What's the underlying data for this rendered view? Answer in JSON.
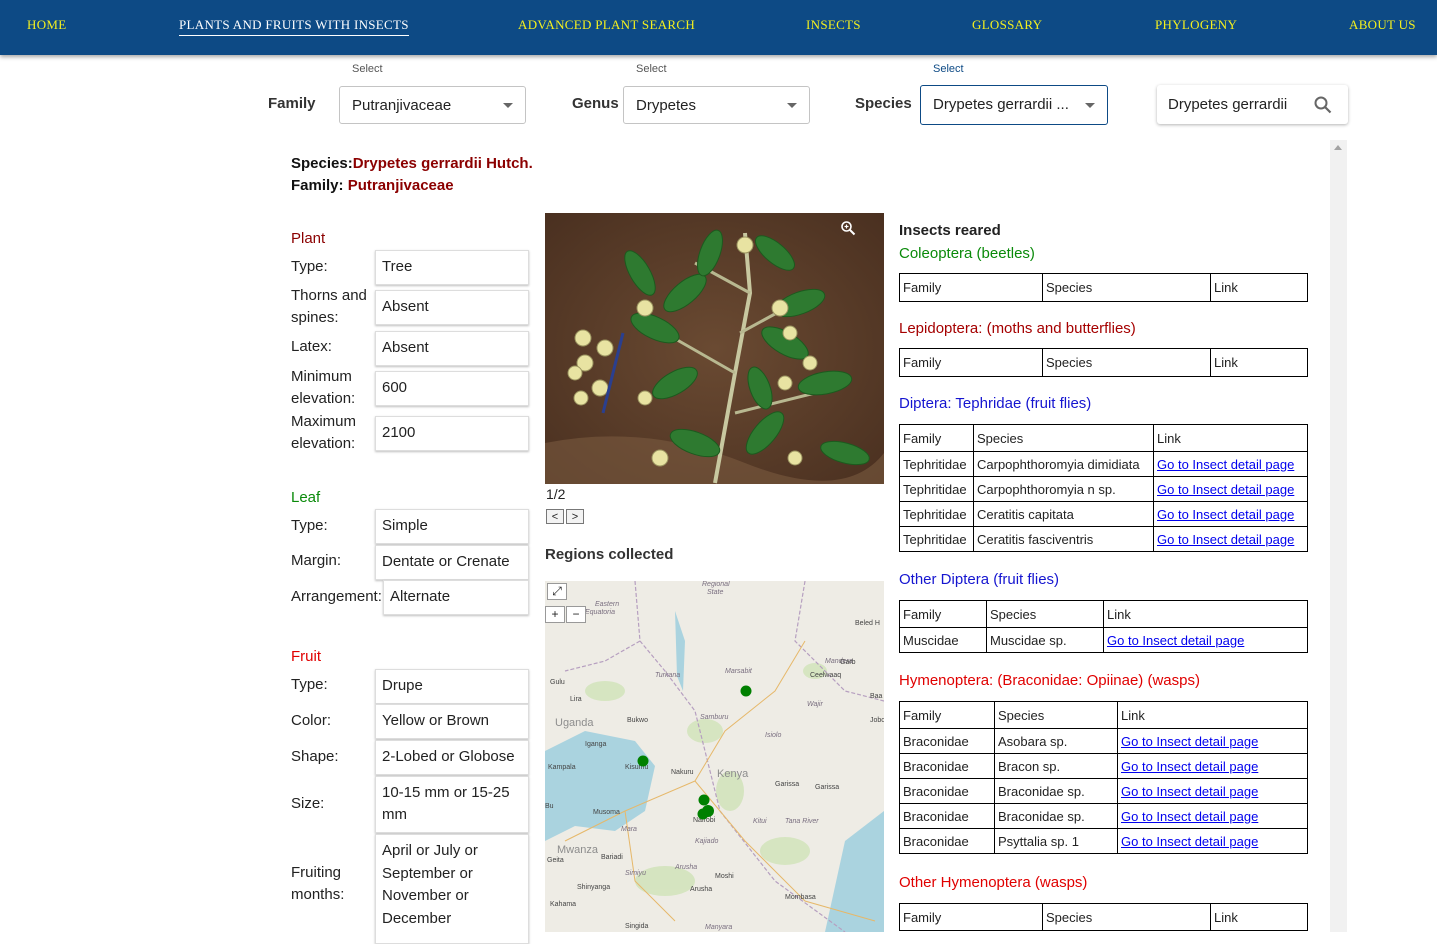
{
  "nav": {
    "home": "HOME",
    "plants": "PLANTS AND FRUITS WITH INSECTS",
    "advanced": "ADVANCED PLANT SEARCH",
    "insects": "INSECTS",
    "glossary": "GLOSSARY",
    "phylogeny": "PHYLOGENY",
    "about": "ABOUT US"
  },
  "filters": {
    "caption": "Select",
    "family_label": "Family",
    "family_value": "Putranjivaceae",
    "genus_label": "Genus",
    "genus_value": "Drypetes",
    "species_label": "Species",
    "species_value": "Drypetes gerrardii ...",
    "search_value": "Drypetes gerrardii",
    "search_icon": "search-icon"
  },
  "header": {
    "species_key": "Species:",
    "species_value": "Drypetes gerrardii Hutch.",
    "family_key": "Family: ",
    "family_value": "Putranjivaceae"
  },
  "plant": {
    "title": "Plant",
    "type_label": "Type:",
    "type": "Tree",
    "thorns_label": "Thorns and spines:",
    "thorns": "Absent",
    "latex_label": "Latex:",
    "latex": "Absent",
    "min_label": "Minimum elevation:",
    "min": "600",
    "max_label": "Maximum elevation:",
    "max": "2100"
  },
  "leaf": {
    "title": "Leaf",
    "type_label": "Type:",
    "type": "Simple",
    "margin_label": "Margin:",
    "margin": "Dentate or Crenate",
    "arrangement_label": "Arrangement:",
    "arrangement": "Alternate"
  },
  "fruit": {
    "title": "Fruit",
    "type_label": "Type:",
    "type": "Drupe",
    "color_label": "Color:",
    "color": "Yellow or Brown",
    "shape_label": "Shape:",
    "shape": "2-Lobed or Globose",
    "size_label": "Size:",
    "size": "10-15 mm or 15-25 mm",
    "months_label": "Fruiting months:",
    "months": "April or July or September or November or December"
  },
  "gallery": {
    "counter": "1/2",
    "prev": "<",
    "next": ">",
    "zoom_icon": "zoom-in-icon"
  },
  "regions": {
    "title": "Regions collected",
    "fullscreen": "⤢",
    "zoom_in": "+",
    "zoom_out": "−",
    "places": [
      "Eastern Equatoria",
      "Turkana",
      "Marsabit",
      "Wajir",
      "Mandera",
      "Garba",
      "Beled H",
      "Ceelwaaq",
      "Baa",
      "Gulu",
      "Lira",
      "Uganda",
      "Bukwo",
      "Samburu",
      "Isiolo",
      "Jobo",
      "Iganga",
      "Kampala",
      "Kisumu",
      "Nakuru",
      "Kenya",
      "Garissa",
      "Bu",
      "Musoma",
      "Mara",
      "Nairobi",
      "Kitui",
      "Tana River",
      "Kajiado",
      "Mwanza",
      "Bariadi",
      "Geita",
      "Simiyu",
      "Arusha",
      "Moshi",
      "Shinyanga",
      "Mombasa",
      "Kahama",
      "Singida",
      "Manyara",
      "Regional State",
      "Garissa"
    ],
    "colors": {
      "marker": "#008000"
    }
  },
  "insects": {
    "title": "Insects reared",
    "headers": [
      "Family",
      "Species",
      "Link"
    ],
    "link_text": "Go to Insect detail page",
    "coleoptera": {
      "title": "Coleoptera (beetles)",
      "rows": []
    },
    "lepidoptera": {
      "title": "Lepidoptera: (moths and butterflies)",
      "rows": []
    },
    "tephritidae": {
      "title": "Diptera: Tephridae (fruit flies)",
      "rows": [
        [
          "Tephritidae",
          "Carpophthoromyia dimidiata"
        ],
        [
          "Tephritidae",
          "Carpophthoromyia n sp."
        ],
        [
          "Tephritidae",
          "Ceratitis capitata"
        ],
        [
          "Tephritidae",
          "Ceratitis fasciventris"
        ]
      ]
    },
    "other_diptera": {
      "title": "Other Diptera (fruit flies)",
      "rows": [
        [
          "Muscidae",
          "Muscidae sp."
        ]
      ]
    },
    "hymenoptera": {
      "title": "Hymenoptera: (Braconidae: Opiinae) (wasps)",
      "rows": [
        [
          "Braconidae",
          "Asobara sp."
        ],
        [
          "Braconidae",
          "Bracon sp."
        ],
        [
          "Braconidae",
          "Braconidae sp."
        ],
        [
          "Braconidae",
          "Braconidae sp."
        ],
        [
          "Braconidae",
          "Psyttalia sp. 1"
        ]
      ]
    },
    "other_hymenoptera": {
      "title": "Other Hymenoptera (wasps)",
      "rows": []
    }
  },
  "colors": {
    "nav_bg": "#0d4a85",
    "nav_text": "#f4f01e",
    "plant_title": "#8b0000",
    "leaf_title": "#0a8a0a",
    "fruit_title": "#e00000",
    "coleoptera": "#0a8a0a",
    "lepidoptera": "#a50000",
    "diptera": "#1515d0",
    "hymenoptera": "#e00000"
  }
}
